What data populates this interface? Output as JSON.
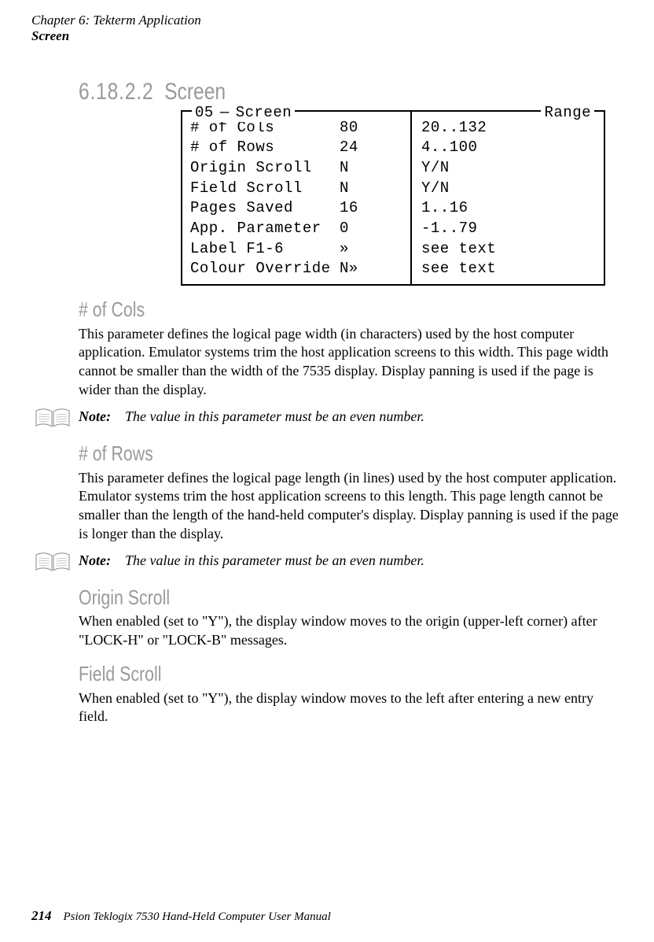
{
  "header": {
    "chapter_line": "Chapter  6:   Tekterm Application",
    "section_line": "Screen"
  },
  "section_heading": {
    "number": "6.18.2.2",
    "title": "Screen"
  },
  "terminal": {
    "legend_left": "05",
    "legend_mid": "Screen",
    "legend_right": "Range",
    "rows": [
      {
        "label": "# of Cols",
        "value": "80",
        "range": "20..132"
      },
      {
        "label": "# of Rows",
        "value": "24",
        "range": "4..100"
      },
      {
        "label": "Origin Scroll",
        "value": "N",
        "range": "Y/N"
      },
      {
        "label": "Field Scroll",
        "value": "N",
        "range": "Y/N"
      },
      {
        "label": "Pages Saved",
        "value": "16",
        "range": "1..16"
      },
      {
        "label": "App. Parameter",
        "value": "0",
        "range": "-1..79"
      },
      {
        "label": "Label F1-6",
        "value": "»",
        "range": "see text"
      },
      {
        "label": "Colour Override",
        "value": "N»",
        "range": "see text"
      }
    ]
  },
  "sections": {
    "cols": {
      "heading": "# of Cols",
      "body": "This parameter defines the logical page width (in characters) used by the host computer application. Emulator systems trim the host application screens to this width. This page width cannot be smaller than the width of the 7535 display. Display panning is used if the page is wider than the display.",
      "note_label": "Note:",
      "note_text": "The value in this parameter must be an even number."
    },
    "rows": {
      "heading": "# of Rows",
      "body": "This parameter defines the logical page length (in lines) used by the host computer application. Emulator systems trim the host application screens to this length. This page length cannot be smaller than the length of the hand-held computer's display. Display panning is used if the page is longer than the display.",
      "note_label": "Note:",
      "note_text": "The value in this parameter must be an even number."
    },
    "origin": {
      "heading": "Origin Scroll",
      "body": "When enabled (set to \"Y\"), the display window moves to the origin (upper-left corner) after \"LOCK-H\" or \"LOCK-B\" messages."
    },
    "field": {
      "heading": "Field Scroll",
      "body": "When enabled (set to \"Y\"), the display window moves to the left after entering a new entry field."
    }
  },
  "footer": {
    "page_number": "214",
    "manual_title": "Psion Teklogix 7530 Hand-Held Computer User Manual"
  }
}
